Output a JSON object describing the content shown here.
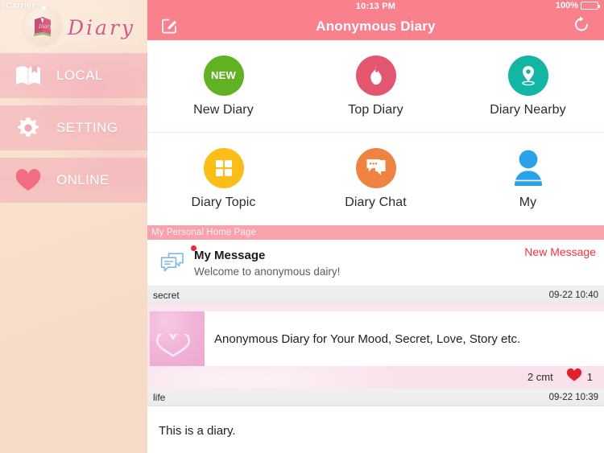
{
  "sidebar": {
    "status": {
      "carrier": "Carrier",
      "wifi_icon": "wifi-icon"
    },
    "logo": {
      "icon": "diary-book-icon",
      "word": "Diary"
    },
    "nav": [
      {
        "label": "LOCAL",
        "icon": "open-book-icon"
      },
      {
        "label": "SETTING",
        "icon": "gear-icon"
      },
      {
        "label": "ONLINE",
        "icon": "heart-icon"
      }
    ]
  },
  "header": {
    "time": "10:13 PM",
    "battery_text": "100%",
    "battery_icon": "battery-full-icon",
    "title": "Anonymous Diary",
    "compose_icon": "compose-square-pencil-icon",
    "refresh_icon": "refresh-circular-arrow-icon",
    "background_color": "#f9808d"
  },
  "grid": {
    "rows": [
      [
        {
          "label": "New Diary",
          "icon": "new-badge-icon",
          "badge": "NEW",
          "color": "#60b222"
        },
        {
          "label": "Top Diary",
          "icon": "flame-icon",
          "badge": "",
          "color": "#e35670"
        },
        {
          "label": "Diary Nearby",
          "icon": "map-pin-icon",
          "badge": "",
          "color": "#13b5a4"
        }
      ],
      [
        {
          "label": "Diary Topic",
          "icon": "grid-squares-icon",
          "badge": "",
          "color": "#fbbd17"
        },
        {
          "label": "Diary Chat",
          "icon": "chat-bubbles-icon",
          "badge": "",
          "color": "#ef8341"
        },
        {
          "label": "My",
          "icon": "person-avatar-icon",
          "badge": "",
          "color": "#2aa1e8"
        }
      ]
    ]
  },
  "section_bar": {
    "label": "My Personal Home Page",
    "color": "#f7a2ac"
  },
  "my_message": {
    "icon": "chat-bubbles-outline-icon",
    "unread_dot": "unread-dot-icon",
    "title": "My Message",
    "subtitle": "Welcome to anonymous dairy!",
    "action_label": "New Message",
    "action_color": "#f7313f"
  },
  "feed": {
    "entries": [
      {
        "category": "secret",
        "time": "09-22 10:40",
        "thumbnail": "pink-heart-photo",
        "text": "Anonymous Diary for Your Mood, Secret, Love, Story etc.",
        "comments": "2 cmt",
        "like_icon": "heart-icon",
        "likes": "1",
        "style": "pink"
      },
      {
        "category": "life",
        "time": "09-22 10:39",
        "text": "This is a diary.",
        "style": "plain"
      }
    ]
  }
}
